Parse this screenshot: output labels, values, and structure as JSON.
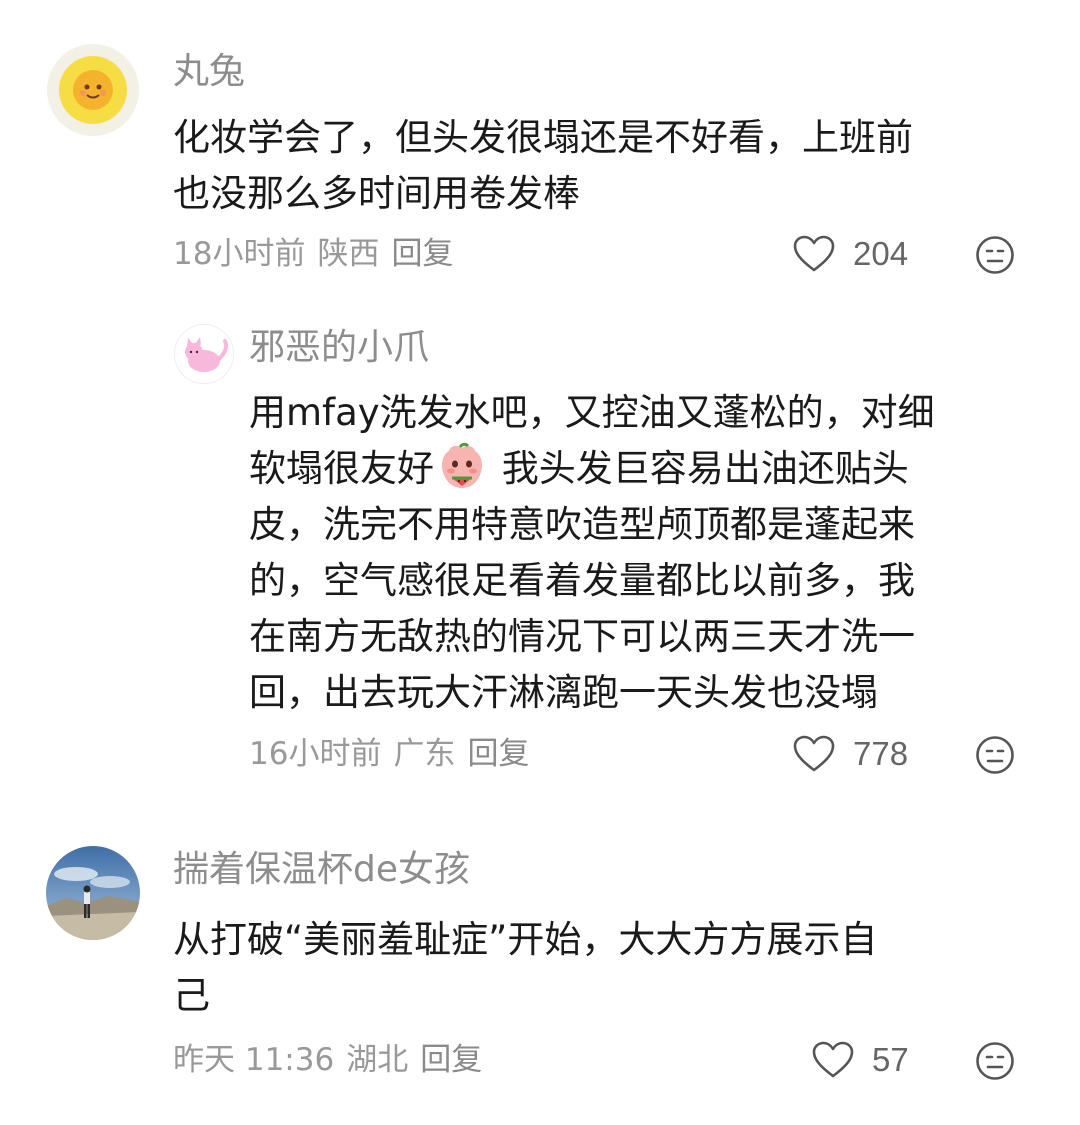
{
  "comments": [
    {
      "username": "丸兔",
      "avatar_icon": "sun-avatar-icon",
      "lines": [
        "化妆学会了，但头发很塌还是不好看，上班前",
        "也没那么多时间用卷发棒"
      ],
      "time": "18小时前",
      "location": "陕西",
      "reply_label": "回复",
      "likes": "204",
      "replies": [
        {
          "username": "邪恶的小爪",
          "avatar_icon": "pink-cat-avatar-icon",
          "line1_before_emoji": "用mfay洗发水吧，又控油又蓬松的，对细",
          "line2_before_emoji": "软塌很友好",
          "emoji_icon": "watermelon-peach-emoji-icon",
          "line2_after_emoji": " 我头发巨容易出油还贴头",
          "lines_rest": [
            "皮，洗完不用特意吹造型颅顶都是蓬起来",
            "的，空气感很足看着发量都比以前多，我",
            "在南方无敌热的情况下可以两三天才洗一",
            "回，出去玩大汗淋漓跑一天头发也没塌"
          ],
          "time": "16小时前",
          "location": "广东",
          "reply_label": "回复",
          "likes": "778"
        }
      ]
    },
    {
      "username": "揣着保温杯de女孩",
      "avatar_icon": "landscape-photo-avatar-icon",
      "lines": [
        "从打破“美丽羞耻症”开始，大大方方展示自",
        "己"
      ],
      "time": "昨天 11:36",
      "location": "湖北",
      "reply_label": "回复",
      "likes": "57"
    }
  ],
  "colors": {
    "text_primary": "#1a1a1a",
    "text_secondary": "#999999",
    "icon_gray": "#555555"
  }
}
